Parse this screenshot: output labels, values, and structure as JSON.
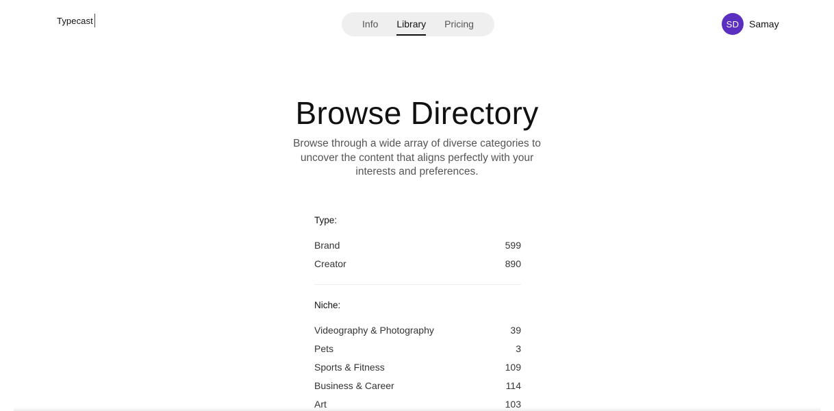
{
  "header": {
    "logo": "Typecast",
    "nav": [
      {
        "label": "Info",
        "active": false
      },
      {
        "label": "Library",
        "active": true
      },
      {
        "label": "Pricing",
        "active": false
      }
    ],
    "user": {
      "initials": "SD",
      "name": "Samay",
      "avatar_color": "#5b2fbf"
    }
  },
  "hero": {
    "title": "Browse Directory",
    "subtitle": "Browse through a wide array of diverse categories to uncover the content that aligns perfectly with your interests and preferences."
  },
  "directory": {
    "type": {
      "title": "Type:",
      "items": [
        {
          "label": "Brand",
          "count": "599"
        },
        {
          "label": "Creator",
          "count": "890"
        }
      ]
    },
    "niche": {
      "title": "Niche:",
      "items": [
        {
          "label": "Videography & Photography",
          "count": "39"
        },
        {
          "label": "Pets",
          "count": "3"
        },
        {
          "label": "Sports & Fitness",
          "count": "109"
        },
        {
          "label": "Business & Career",
          "count": "114"
        },
        {
          "label": "Art",
          "count": "103"
        }
      ]
    }
  }
}
